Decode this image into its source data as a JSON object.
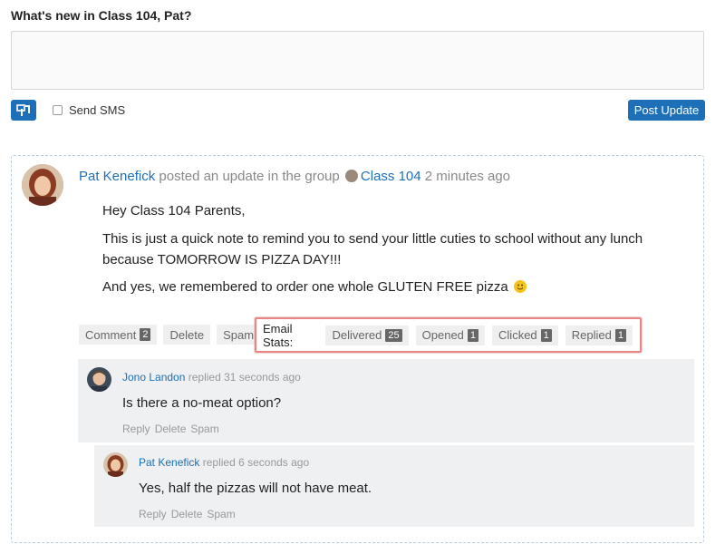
{
  "composer": {
    "prompt": "What's new in Class 104, Pat?",
    "textarea_value": "",
    "send_sms_label": "Send SMS",
    "send_sms_checked": false,
    "post_button": "Post Update"
  },
  "post": {
    "author": "Pat Kenefick",
    "action_text": "posted an update in the group",
    "group": "Class 104",
    "time": "2 minutes ago",
    "body": [
      "Hey Class 104 Parents,",
      "This is just a quick note to remind you to send your little cuties to school without any lunch",
      "because TOMORROW IS PIZZA DAY!!!",
      "And yes, we remembered to order one whole GLUTEN FREE pizza"
    ],
    "actions": {
      "comment_label": "Comment",
      "comment_count": "2",
      "delete_label": "Delete",
      "spam_label": "Spam"
    },
    "email_stats": {
      "label": "Email Stats:",
      "delivered_label": "Delivered",
      "delivered_count": "25",
      "opened_label": "Opened",
      "opened_count": "1",
      "clicked_label": "Clicked",
      "clicked_count": "1",
      "replied_label": "Replied",
      "replied_count": "1"
    }
  },
  "comments": [
    {
      "author": "Jono Landon",
      "action": "replied",
      "time": "31 seconds ago",
      "text": "Is there a no-meat option?",
      "reply_label": "Reply",
      "delete_label": "Delete",
      "spam_label": "Spam"
    },
    {
      "author": "Pat Kenefick",
      "action": "replied",
      "time": "6 seconds ago",
      "text": "Yes, half the pizzas will not have meat.",
      "reply_label": "Reply",
      "delete_label": "Delete",
      "spam_label": "Spam"
    }
  ],
  "colors": {
    "accent": "#1d6fb8",
    "highlight_border": "#e88686",
    "comment_bg": "#eef0f2"
  }
}
